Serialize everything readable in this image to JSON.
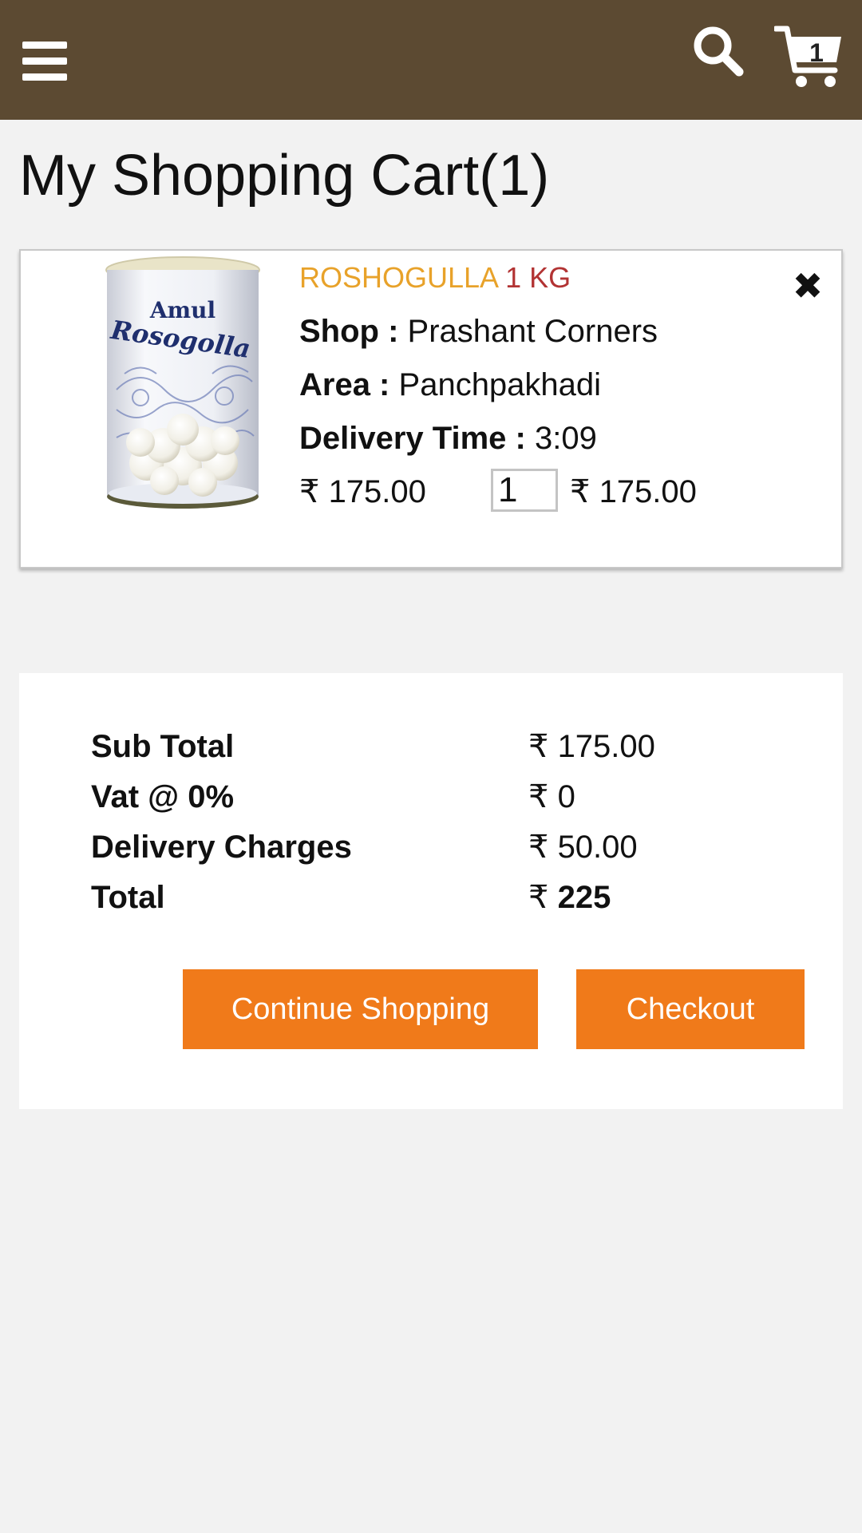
{
  "header": {
    "menu_icon": "hamburger-menu-icon",
    "search_icon": "search-icon",
    "cart_icon": "shopping-cart-icon",
    "cart_count": "1",
    "background_color": "#5c4a32"
  },
  "page": {
    "title": "My Shopping Cart(1)"
  },
  "cart_items": [
    {
      "image_alt": "Amul Rosogolla can",
      "image_text_brand": "Amul",
      "image_text_product": "Rosogolla",
      "name": "ROSHOGULLA",
      "size": "1 KG",
      "shop_label": "Shop :",
      "shop": "Prashant Corners",
      "area_label": "Area :",
      "area": "Panchpakhadi",
      "delivery_label": "Delivery Time :",
      "delivery_time": "3:09",
      "unit_price": "₹ 175.00",
      "quantity": "1",
      "line_total": "₹ 175.00",
      "remove_icon": "close-icon"
    }
  ],
  "summary": {
    "subtotal_label": "Sub Total",
    "subtotal_value": "₹ 175.00",
    "vat_label": "Vat @ 0%",
    "vat_value": "₹ 0",
    "delivery_label": "Delivery Charges",
    "delivery_value": "₹ 50.00",
    "total_label": "Total",
    "total_currency": "₹",
    "total_value": "225"
  },
  "actions": {
    "continue_label": "Continue Shopping",
    "checkout_label": "Checkout",
    "button_color": "#f07a1a"
  }
}
